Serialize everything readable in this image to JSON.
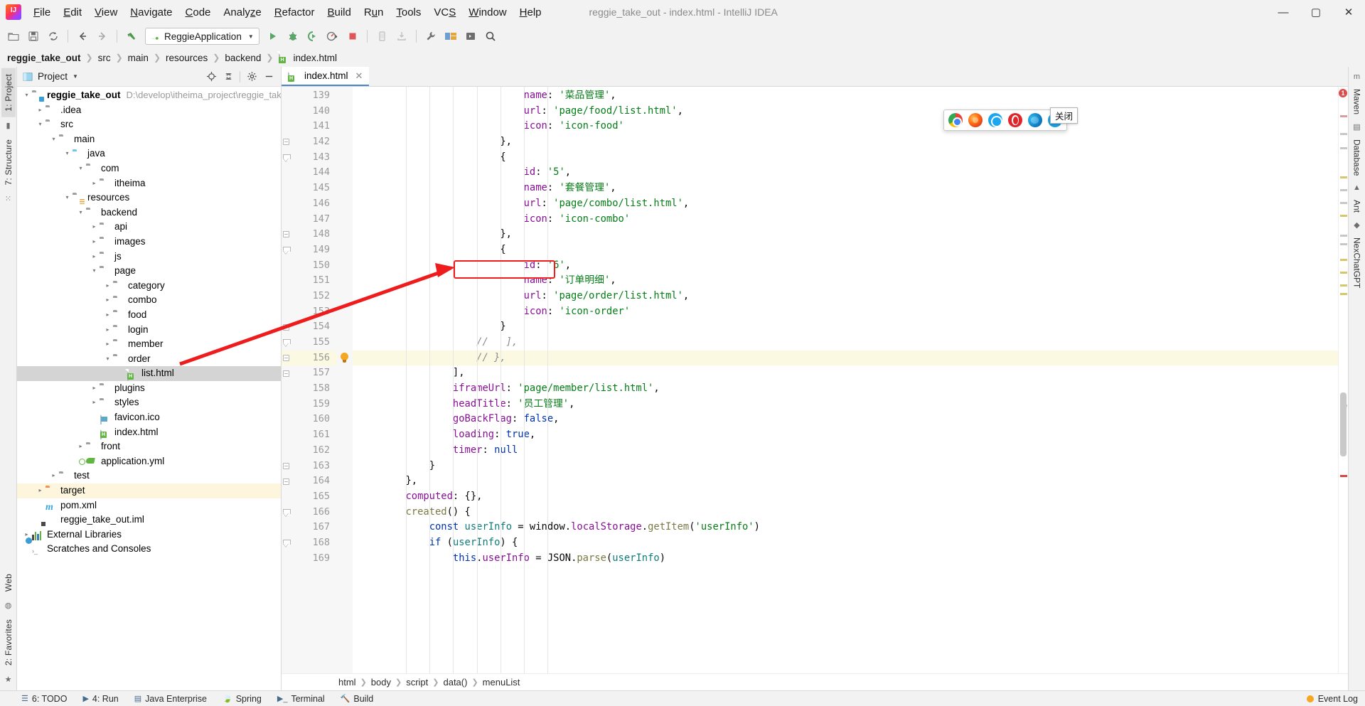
{
  "window": {
    "title": "reggie_take_out - index.html - IntelliJ IDEA",
    "minimize": "—",
    "maximize": "▢",
    "close": "✕"
  },
  "menubar": {
    "items": [
      {
        "label": "File"
      },
      {
        "label": "Edit"
      },
      {
        "label": "View"
      },
      {
        "label": "Navigate"
      },
      {
        "label": "Code"
      },
      {
        "label": "Analyze"
      },
      {
        "label": "Refactor"
      },
      {
        "label": "Build"
      },
      {
        "label": "Run"
      },
      {
        "label": "Tools"
      },
      {
        "label": "VCS"
      },
      {
        "label": "Window"
      },
      {
        "label": "Help"
      }
    ]
  },
  "toolbar": {
    "run_config": "ReggieApplication",
    "icons": [
      "open-folder-icon",
      "save-icon",
      "sync-icon",
      "back-arrow-icon",
      "forward-arrow-icon",
      "undo-icon",
      "run-icon",
      "debug-icon",
      "run-with-coverage-icon",
      "profiler-icon",
      "stop-icon",
      "phone-icon",
      "download-icon",
      "wrench-icon",
      "layout-icon",
      "play-terminal-icon",
      "search-everywhere-icon"
    ]
  },
  "breadcrumb": {
    "items": [
      "reggie_take_out",
      "src",
      "main",
      "resources",
      "backend",
      "index.html"
    ]
  },
  "left_rail": {
    "tabs": [
      "1: Project",
      "7: Structure",
      "2: Favorites",
      "Web"
    ]
  },
  "right_rail": {
    "tabs": [
      "Maven",
      "Database",
      "Ant",
      "NexChatGPT"
    ]
  },
  "project_panel": {
    "title": "Project",
    "actions": [
      "locate-icon",
      "collapse-all-icon",
      "gear-icon",
      "hide-icon"
    ],
    "tree": [
      {
        "depth": 0,
        "twisty": "▾",
        "icon": "module-folder",
        "label": "reggie_take_out",
        "bold": true,
        "path": "D:\\develop\\itheima_project\\reggie_take",
        "state": "normal"
      },
      {
        "depth": 1,
        "twisty": "▸",
        "icon": "folder",
        "label": ".idea",
        "state": "normal"
      },
      {
        "depth": 1,
        "twisty": "▾",
        "icon": "folder",
        "label": "src",
        "state": "normal"
      },
      {
        "depth": 2,
        "twisty": "▾",
        "icon": "folder",
        "label": "main",
        "state": "normal"
      },
      {
        "depth": 3,
        "twisty": "▾",
        "icon": "folder-blue",
        "label": "java",
        "state": "normal"
      },
      {
        "depth": 4,
        "twisty": "▾",
        "icon": "package",
        "label": "com",
        "state": "normal"
      },
      {
        "depth": 5,
        "twisty": "▸",
        "icon": "package",
        "label": "itheima",
        "state": "normal"
      },
      {
        "depth": 3,
        "twisty": "▾",
        "icon": "folder-resources",
        "label": "resources",
        "state": "normal"
      },
      {
        "depth": 4,
        "twisty": "▾",
        "icon": "folder",
        "label": "backend",
        "state": "normal"
      },
      {
        "depth": 5,
        "twisty": "▸",
        "icon": "folder",
        "label": "api",
        "state": "normal"
      },
      {
        "depth": 5,
        "twisty": "▸",
        "icon": "folder",
        "label": "images",
        "state": "normal"
      },
      {
        "depth": 5,
        "twisty": "▸",
        "icon": "folder",
        "label": "js",
        "state": "normal"
      },
      {
        "depth": 5,
        "twisty": "▾",
        "icon": "folder",
        "label": "page",
        "state": "normal"
      },
      {
        "depth": 6,
        "twisty": "▸",
        "icon": "folder",
        "label": "category",
        "state": "normal"
      },
      {
        "depth": 6,
        "twisty": "▸",
        "icon": "folder",
        "label": "combo",
        "state": "normal"
      },
      {
        "depth": 6,
        "twisty": "▸",
        "icon": "folder",
        "label": "food",
        "state": "normal"
      },
      {
        "depth": 6,
        "twisty": "▸",
        "icon": "folder",
        "label": "login",
        "state": "normal"
      },
      {
        "depth": 6,
        "twisty": "▸",
        "icon": "folder",
        "label": "member",
        "state": "normal"
      },
      {
        "depth": 6,
        "twisty": "▾",
        "icon": "folder",
        "label": "order",
        "state": "normal"
      },
      {
        "depth": 7,
        "twisty": "",
        "icon": "html-file",
        "label": "list.html",
        "state": "selected"
      },
      {
        "depth": 5,
        "twisty": "▸",
        "icon": "folder",
        "label": "plugins",
        "state": "normal"
      },
      {
        "depth": 5,
        "twisty": "▸",
        "icon": "folder",
        "label": "styles",
        "state": "normal"
      },
      {
        "depth": 5,
        "twisty": "",
        "icon": "ico-file",
        "label": "favicon.ico",
        "state": "normal"
      },
      {
        "depth": 5,
        "twisty": "",
        "icon": "html-file",
        "label": "index.html",
        "state": "normal"
      },
      {
        "depth": 4,
        "twisty": "▸",
        "icon": "folder",
        "label": "front",
        "state": "normal"
      },
      {
        "depth": 4,
        "twisty": "",
        "icon": "yml-file",
        "label": "application.yml",
        "state": "normal"
      },
      {
        "depth": 2,
        "twisty": "▸",
        "icon": "folder",
        "label": "test",
        "state": "normal"
      },
      {
        "depth": 1,
        "twisty": "▸",
        "icon": "folder-orange",
        "label": "target",
        "state": "highlight"
      },
      {
        "depth": 1,
        "twisty": "",
        "icon": "maven-file",
        "label": "pom.xml",
        "state": "normal"
      },
      {
        "depth": 1,
        "twisty": "",
        "icon": "iml-file",
        "label": "reggie_take_out.iml",
        "state": "normal"
      },
      {
        "depth": 0,
        "twisty": "▸",
        "icon": "library",
        "label": "External Libraries",
        "state": "normal"
      },
      {
        "depth": 0,
        "twisty": "",
        "icon": "scratch",
        "label": "Scratches and Consoles",
        "state": "normal"
      }
    ]
  },
  "editor": {
    "tab": {
      "label": "index.html",
      "icon": "html-file-icon",
      "close": "✕"
    },
    "first_line_number": 139,
    "current_line": 156,
    "lines": [
      {
        "n": 139,
        "indent": 7,
        "tokens": [
          {
            "t": "name",
            "c": "prop"
          },
          {
            "t": ": ",
            "c": "punct"
          },
          {
            "t": "'菜品管理'",
            "c": "str"
          },
          {
            "t": ",",
            "c": "punct"
          }
        ]
      },
      {
        "n": 140,
        "indent": 7,
        "tokens": [
          {
            "t": "url",
            "c": "prop"
          },
          {
            "t": ": ",
            "c": "punct"
          },
          {
            "t": "'page/food/list.html'",
            "c": "str"
          },
          {
            "t": ",",
            "c": "punct"
          }
        ]
      },
      {
        "n": 141,
        "indent": 7,
        "tokens": [
          {
            "t": "icon",
            "c": "prop"
          },
          {
            "t": ": ",
            "c": "punct"
          },
          {
            "t": "'icon-food'",
            "c": "str"
          }
        ]
      },
      {
        "n": 142,
        "indent": 6,
        "fold": "open",
        "tokens": [
          {
            "t": "},",
            "c": "punct"
          }
        ]
      },
      {
        "n": 143,
        "indent": 6,
        "fold": "arrow",
        "tokens": [
          {
            "t": "{",
            "c": "punct"
          }
        ]
      },
      {
        "n": 144,
        "indent": 7,
        "tokens": [
          {
            "t": "id",
            "c": "prop"
          },
          {
            "t": ": ",
            "c": "punct"
          },
          {
            "t": "'5'",
            "c": "str"
          },
          {
            "t": ",",
            "c": "punct"
          }
        ]
      },
      {
        "n": 145,
        "indent": 7,
        "tokens": [
          {
            "t": "name",
            "c": "prop"
          },
          {
            "t": ": ",
            "c": "punct"
          },
          {
            "t": "'套餐管理'",
            "c": "str"
          },
          {
            "t": ",",
            "c": "punct"
          }
        ]
      },
      {
        "n": 146,
        "indent": 7,
        "tokens": [
          {
            "t": "url",
            "c": "prop"
          },
          {
            "t": ": ",
            "c": "punct"
          },
          {
            "t": "'page/combo/list.html'",
            "c": "str"
          },
          {
            "t": ",",
            "c": "punct"
          }
        ]
      },
      {
        "n": 147,
        "indent": 7,
        "tokens": [
          {
            "t": "icon",
            "c": "prop"
          },
          {
            "t": ": ",
            "c": "punct"
          },
          {
            "t": "'icon-combo'",
            "c": "str"
          }
        ]
      },
      {
        "n": 148,
        "indent": 6,
        "fold": "open",
        "tokens": [
          {
            "t": "},",
            "c": "punct"
          }
        ]
      },
      {
        "n": 149,
        "indent": 6,
        "fold": "arrow",
        "tokens": [
          {
            "t": "{",
            "c": "punct"
          }
        ]
      },
      {
        "n": 150,
        "indent": 7,
        "tokens": [
          {
            "t": "id",
            "c": "prop"
          },
          {
            "t": ": ",
            "c": "punct"
          },
          {
            "t": "'6'",
            "c": "str"
          },
          {
            "t": ",",
            "c": "punct"
          }
        ]
      },
      {
        "n": 151,
        "indent": 7,
        "tokens": [
          {
            "t": "name",
            "c": "prop"
          },
          {
            "t": ": ",
            "c": "punct"
          },
          {
            "t": "'订单明细'",
            "c": "str"
          },
          {
            "t": ",",
            "c": "punct"
          }
        ]
      },
      {
        "n": 152,
        "indent": 7,
        "tokens": [
          {
            "t": "url",
            "c": "prop"
          },
          {
            "t": ": ",
            "c": "punct"
          },
          {
            "t": "'page/order/list.html'",
            "c": "str"
          },
          {
            "t": ",",
            "c": "punct"
          }
        ]
      },
      {
        "n": 153,
        "indent": 7,
        "tokens": [
          {
            "t": "icon",
            "c": "prop"
          },
          {
            "t": ": ",
            "c": "punct"
          },
          {
            "t": "'icon-order'",
            "c": "str"
          }
        ]
      },
      {
        "n": 154,
        "indent": 6,
        "fold": "open",
        "tokens": [
          {
            "t": "}",
            "c": "punct"
          }
        ]
      },
      {
        "n": 155,
        "indent": 5,
        "fold": "arrow",
        "tokens": [
          {
            "t": "//   ],",
            "c": "cmt"
          }
        ]
      },
      {
        "n": 156,
        "indent": 5,
        "fold": "open",
        "bulb": true,
        "tokens": [
          {
            "t": "// },",
            "c": "cmt"
          }
        ]
      },
      {
        "n": 157,
        "indent": 4,
        "fold": "open",
        "tokens": [
          {
            "t": "],",
            "c": "punct"
          }
        ]
      },
      {
        "n": 158,
        "indent": 4,
        "tokens": [
          {
            "t": "iframeUrl",
            "c": "prop"
          },
          {
            "t": ": ",
            "c": "punct"
          },
          {
            "t": "'page/member/list.html'",
            "c": "str"
          },
          {
            "t": ",",
            "c": "punct"
          }
        ]
      },
      {
        "n": 159,
        "indent": 4,
        "tokens": [
          {
            "t": "headTitle",
            "c": "prop"
          },
          {
            "t": ": ",
            "c": "punct"
          },
          {
            "t": "'员工管理'",
            "c": "str"
          },
          {
            "t": ",",
            "c": "punct"
          }
        ]
      },
      {
        "n": 160,
        "indent": 4,
        "tokens": [
          {
            "t": "goBackFlag",
            "c": "prop"
          },
          {
            "t": ": ",
            "c": "punct"
          },
          {
            "t": "false",
            "c": "kw"
          },
          {
            "t": ",",
            "c": "punct"
          }
        ]
      },
      {
        "n": 161,
        "indent": 4,
        "tokens": [
          {
            "t": "loading",
            "c": "prop"
          },
          {
            "t": ": ",
            "c": "punct"
          },
          {
            "t": "true",
            "c": "kw"
          },
          {
            "t": ",",
            "c": "punct"
          }
        ]
      },
      {
        "n": 162,
        "indent": 4,
        "tokens": [
          {
            "t": "timer",
            "c": "prop"
          },
          {
            "t": ": ",
            "c": "punct"
          },
          {
            "t": "null",
            "c": "kw"
          }
        ]
      },
      {
        "n": 163,
        "indent": 3,
        "fold": "open",
        "tokens": [
          {
            "t": "}",
            "c": "punct"
          }
        ]
      },
      {
        "n": 164,
        "indent": 2,
        "fold": "open",
        "tokens": [
          {
            "t": "},",
            "c": "punct"
          }
        ]
      },
      {
        "n": 165,
        "indent": 2,
        "tokens": [
          {
            "t": "computed",
            "c": "prop"
          },
          {
            "t": ": {},",
            "c": "punct"
          }
        ]
      },
      {
        "n": 166,
        "indent": 2,
        "fold": "arrow",
        "tokens": [
          {
            "t": "created",
            "c": "fn"
          },
          {
            "t": "() {",
            "c": "punct"
          }
        ]
      },
      {
        "n": 167,
        "indent": 3,
        "tokens": [
          {
            "t": "const",
            "c": "kw"
          },
          {
            "t": " ",
            "c": "punct"
          },
          {
            "t": "userInfo",
            "c": "local"
          },
          {
            "t": " = ",
            "c": "punct"
          },
          {
            "t": "window",
            "c": "id"
          },
          {
            "t": ".",
            "c": "punct"
          },
          {
            "t": "localStorage",
            "c": "prop"
          },
          {
            "t": ".",
            "c": "punct"
          },
          {
            "t": "getItem",
            "c": "fn"
          },
          {
            "t": "(",
            "c": "punct"
          },
          {
            "t": "'userInfo'",
            "c": "str"
          },
          {
            "t": ")",
            "c": "punct"
          }
        ]
      },
      {
        "n": 168,
        "indent": 3,
        "fold": "arrow",
        "tokens": [
          {
            "t": "if",
            "c": "kw"
          },
          {
            "t": " (",
            "c": "punct"
          },
          {
            "t": "userInfo",
            "c": "local"
          },
          {
            "t": ") {",
            "c": "punct"
          }
        ]
      },
      {
        "n": 169,
        "indent": 4,
        "tokens": [
          {
            "t": "this",
            "c": "kw"
          },
          {
            "t": ".",
            "c": "punct"
          },
          {
            "t": "userInfo",
            "c": "prop"
          },
          {
            "t": " = ",
            "c": "punct"
          },
          {
            "t": "JSON",
            "c": "id"
          },
          {
            "t": ".",
            "c": "punct"
          },
          {
            "t": "parse",
            "c": "fn"
          },
          {
            "t": "(",
            "c": "punct"
          },
          {
            "t": "userInfo",
            "c": "local"
          },
          {
            "t": ")",
            "c": "punct"
          }
        ]
      }
    ],
    "crumbs": [
      "html",
      "body",
      "script",
      "data()",
      "menuList"
    ],
    "error_count": "1"
  },
  "browser_popup": {
    "icons": [
      "chrome-icon",
      "firefox-icon",
      "safari-icon",
      "opera-icon",
      "edge-icon",
      "ie-icon"
    ],
    "tooltip": "关闭"
  },
  "statusbar": {
    "items": [
      {
        "label": "6: TODO",
        "icon": "todo-icon"
      },
      {
        "label": "4: Run",
        "icon": "run-icon"
      },
      {
        "label": "Java Enterprise",
        "icon": "java-ee-icon"
      },
      {
        "label": "Spring",
        "icon": "spring-icon"
      },
      {
        "label": "Terminal",
        "icon": "terminal-icon"
      },
      {
        "label": "Build",
        "icon": "build-icon"
      }
    ],
    "right": {
      "label": "Event Log",
      "icon": "event-log-icon"
    }
  },
  "annotation": {
    "box_color": "#ee1c1c",
    "arrow_color": "#ee1c1c"
  }
}
